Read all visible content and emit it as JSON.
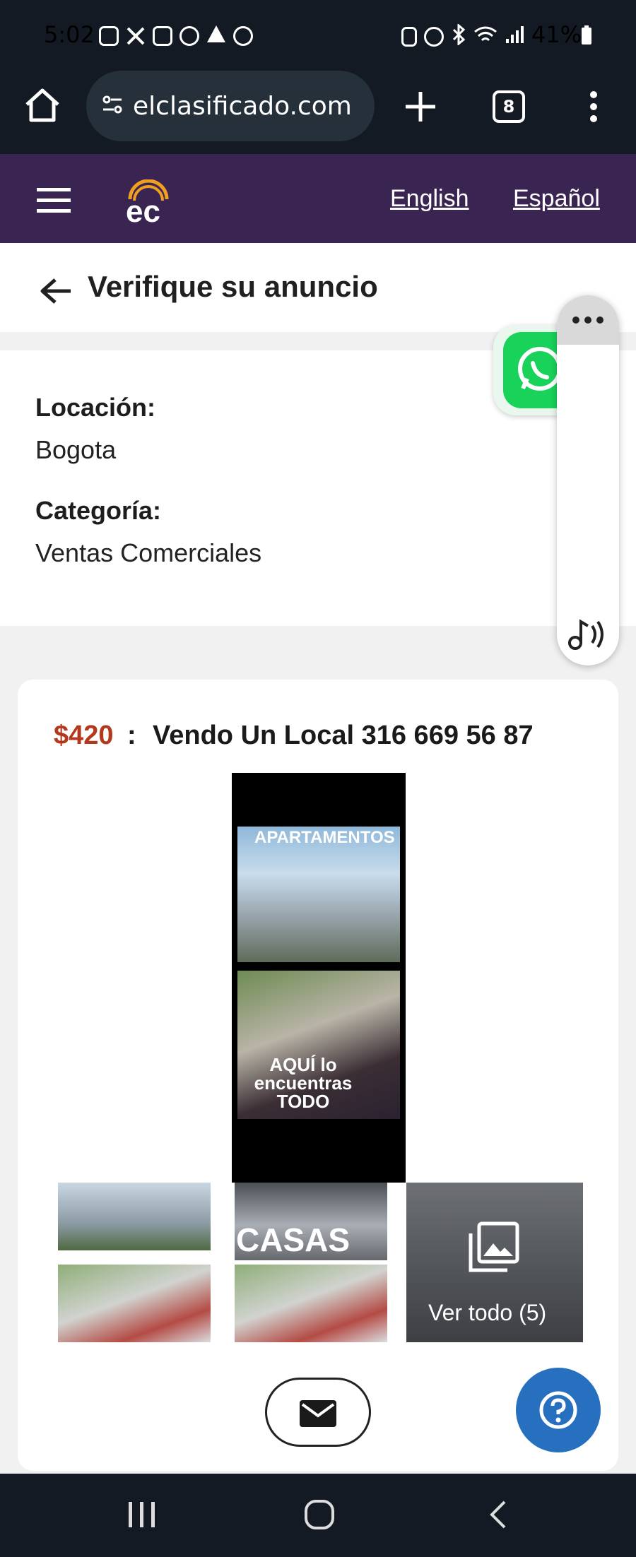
{
  "status_bar": {
    "time": "5:02",
    "battery": "41%"
  },
  "browser": {
    "url": "elclasificado.com",
    "tab_count": "8",
    "colors": {
      "bar": "#141a23",
      "pill": "#26303b"
    }
  },
  "site_header": {
    "logo_text": "ec",
    "lang_english": "English",
    "lang_spanish": "Español",
    "colors": {
      "background": "#3a2452",
      "logo_accent": "#f0a020"
    }
  },
  "page": {
    "title": "Verifique su anuncio"
  },
  "info": {
    "location_label": "Locación:",
    "location_value": "Bogota",
    "category_label": "Categoría:",
    "category_value": "Ventas Comerciales"
  },
  "listing": {
    "price": "$420",
    "separator": ":",
    "title": "Vendo Un Local 316 669 56 87",
    "main_image_text_top": "APARTAMENTOS",
    "main_image_text_bottom": "AQUÍ lo encuentras TODO",
    "thumb_2_text": "CASAS",
    "view_all_label": "Ver todo (5)",
    "colors": {
      "price": "#b3391c"
    }
  },
  "actions": {
    "email_icon": "mail-icon",
    "help_icon": "question-icon",
    "colors": {
      "help_button": "#2770c0"
    }
  }
}
